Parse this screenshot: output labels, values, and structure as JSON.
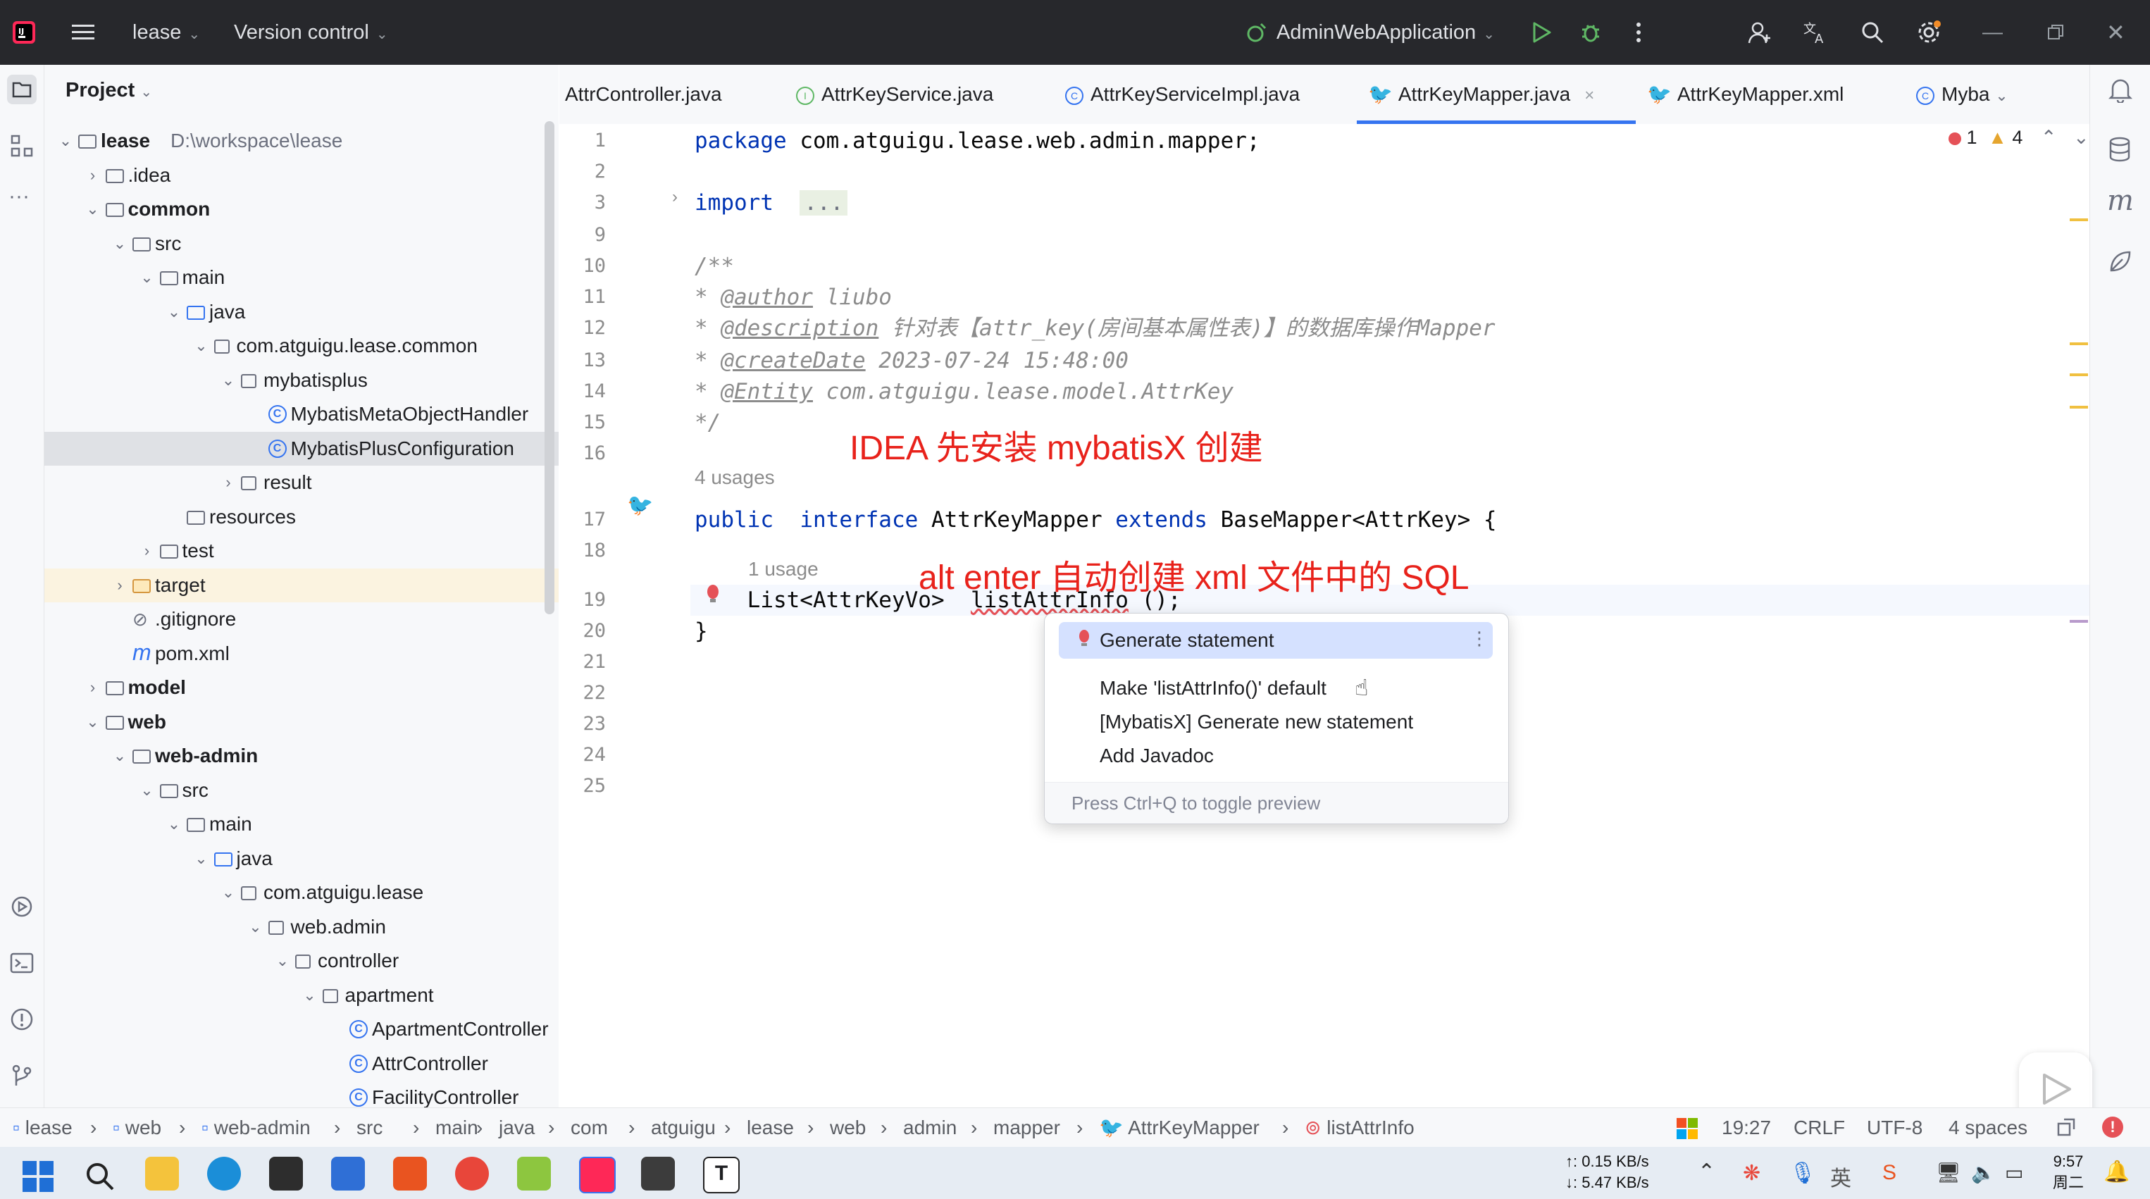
{
  "titlebar": {
    "project": "lease",
    "vcs": "Version control",
    "run_config": "AdminWebApplication"
  },
  "project_panel": {
    "title": "Project",
    "tree": [
      {
        "label": "lease",
        "suffix": "D:\\workspace\\lease",
        "depth": 0,
        "arrow": "open",
        "icon": "module",
        "bold": true
      },
      {
        "label": ".idea",
        "depth": 1,
        "arrow": "closed",
        "icon": "folder"
      },
      {
        "label": "common",
        "depth": 1,
        "arrow": "open",
        "icon": "module",
        "bold": true
      },
      {
        "label": "src",
        "depth": 2,
        "arrow": "open",
        "icon": "folder"
      },
      {
        "label": "main",
        "depth": 3,
        "arrow": "open",
        "icon": "folder"
      },
      {
        "label": "java",
        "depth": 4,
        "arrow": "open",
        "icon": "folder-blue"
      },
      {
        "label": "com.atguigu.lease.common",
        "depth": 5,
        "arrow": "open",
        "icon": "package"
      },
      {
        "label": "mybatisplus",
        "depth": 6,
        "arrow": "open",
        "icon": "package"
      },
      {
        "label": "MybatisMetaObjectHandler",
        "depth": 7,
        "arrow": "none",
        "icon": "class"
      },
      {
        "label": "MybatisPlusConfiguration",
        "depth": 7,
        "arrow": "none",
        "icon": "class",
        "selected": true
      },
      {
        "label": "result",
        "depth": 6,
        "arrow": "closed",
        "icon": "package"
      },
      {
        "label": "resources",
        "depth": 4,
        "arrow": "none",
        "icon": "folder"
      },
      {
        "label": "test",
        "depth": 3,
        "arrow": "closed",
        "icon": "folder"
      },
      {
        "label": "target",
        "depth": 2,
        "arrow": "closed",
        "icon": "folder-orange",
        "target": true
      },
      {
        "label": ".gitignore",
        "depth": 2,
        "arrow": "none",
        "icon": "ignore"
      },
      {
        "label": "pom.xml",
        "depth": 2,
        "arrow": "none",
        "icon": "maven"
      },
      {
        "label": "model",
        "depth": 1,
        "arrow": "closed",
        "icon": "module",
        "bold": true
      },
      {
        "label": "web",
        "depth": 1,
        "arrow": "open",
        "icon": "module",
        "bold": true
      },
      {
        "label": "web-admin",
        "depth": 2,
        "arrow": "open",
        "icon": "module",
        "bold": true
      },
      {
        "label": "src",
        "depth": 3,
        "arrow": "open",
        "icon": "folder"
      },
      {
        "label": "main",
        "depth": 4,
        "arrow": "open",
        "icon": "folder"
      },
      {
        "label": "java",
        "depth": 5,
        "arrow": "open",
        "icon": "folder-blue"
      },
      {
        "label": "com.atguigu.lease",
        "depth": 6,
        "arrow": "open",
        "icon": "package"
      },
      {
        "label": "web.admin",
        "depth": 7,
        "arrow": "open",
        "icon": "package"
      },
      {
        "label": "controller",
        "depth": 8,
        "arrow": "open",
        "icon": "package"
      },
      {
        "label": "apartment",
        "depth": 9,
        "arrow": "open",
        "icon": "package"
      },
      {
        "label": "ApartmentController",
        "depth": 10,
        "arrow": "none",
        "icon": "class"
      },
      {
        "label": "AttrController",
        "depth": 10,
        "arrow": "none",
        "icon": "class"
      },
      {
        "label": "FacilityController",
        "depth": 10,
        "arrow": "none",
        "icon": "class"
      }
    ]
  },
  "tabs": [
    {
      "label": "AttrController.java",
      "icon": "none"
    },
    {
      "label": "AttrKeyService.java",
      "icon": "interface"
    },
    {
      "label": "AttrKeyServiceImpl.java",
      "icon": "class"
    },
    {
      "label": "AttrKeyMapper.java",
      "icon": "mapper",
      "active": true,
      "closable": true
    },
    {
      "label": "AttrKeyMapper.xml",
      "icon": "mapper"
    },
    {
      "label": "Myba",
      "icon": "class"
    }
  ],
  "inspection": {
    "errors": "1",
    "warnings": "4"
  },
  "code_lines": [
    {
      "n": "1",
      "tokens": [
        [
          "kw",
          "package"
        ],
        [
          "",
          "com.atguigu.lease.web.admin.mapper;"
        ]
      ]
    },
    {
      "n": "2",
      "tokens": []
    },
    {
      "n": "3",
      "tokens": [
        [
          "kw",
          "import"
        ],
        [
          "",
          ""
        ],
        [
          "fold",
          "..."
        ]
      ]
    },
    {
      "n": "9",
      "tokens": []
    },
    {
      "n": "10",
      "tokens": [
        [
          "cm",
          "/**"
        ]
      ]
    },
    {
      "n": "11",
      "tokens": [
        [
          "cm",
          "* "
        ],
        [
          "tag",
          "@author"
        ],
        [
          "cm",
          " liubo"
        ]
      ]
    },
    {
      "n": "12",
      "tokens": [
        [
          "cm",
          "* "
        ],
        [
          "tag",
          "@description"
        ],
        [
          "cm",
          " 针对表【attr_key(房间基本属性表)】的数据库操作Mapper"
        ]
      ]
    },
    {
      "n": "13",
      "tokens": [
        [
          "cm",
          "* "
        ],
        [
          "tag",
          "@createDate"
        ],
        [
          "cm",
          " 2023-07-24 15:48:00"
        ]
      ]
    },
    {
      "n": "14",
      "tokens": [
        [
          "cm",
          "* "
        ],
        [
          "tag",
          "@Entity"
        ],
        [
          "cm",
          " com.atguigu.lease.model.AttrKey"
        ]
      ]
    },
    {
      "n": "15",
      "tokens": [
        [
          "cm",
          "*/"
        ]
      ]
    },
    {
      "n": "16",
      "tokens": []
    },
    {
      "n": "17",
      "tokens": [
        [
          "kw",
          "public"
        ],
        [
          "",
          ""
        ],
        [
          "kw",
          "interface"
        ],
        [
          "",
          "AttrKeyMapper"
        ],
        [
          "kw",
          "extends"
        ],
        [
          "",
          "BaseMapper<AttrKey> {"
        ]
      ]
    },
    {
      "n": "18",
      "tokens": []
    },
    {
      "n": "19",
      "tokens": [
        [
          "",
          "    List<AttrKeyVo> "
        ],
        [
          "err",
          "listAttrInfo"
        ],
        [
          "",
          "();"
        ]
      ]
    },
    {
      "n": "20",
      "tokens": [
        [
          "",
          "}"
        ]
      ]
    },
    {
      "n": "21",
      "tokens": []
    },
    {
      "n": "22",
      "tokens": []
    },
    {
      "n": "23",
      "tokens": []
    },
    {
      "n": "24",
      "tokens": []
    },
    {
      "n": "25",
      "tokens": []
    }
  ],
  "hints": {
    "usages_17": "4 usages",
    "usage_19": "1 usage"
  },
  "annotations": {
    "top": "IDEA 先安装 mybatisX 创建",
    "bottom": "alt enter 自动创建 xml 文件中的 SQL"
  },
  "popup": {
    "items": [
      "Generate statement",
      "Make 'listAttrInfo()' default",
      "[MybatisX] Generate new statement",
      "Add Javadoc"
    ],
    "footer": "Press Ctrl+Q to toggle preview"
  },
  "breadcrumbs": [
    "lease",
    "web",
    "web-admin",
    "src",
    "main",
    "java",
    "com",
    "atguigu",
    "lease",
    "web",
    "admin",
    "mapper",
    "AttrKeyMapper",
    "listAttrInfo"
  ],
  "status": {
    "position": "19:27",
    "line_sep": "CRLF",
    "encoding": "UTF-8",
    "indent": "4 spaces"
  },
  "taskbar": {
    "net_up": "↑: 0.15 KB/s",
    "net_down": "↓: 5.47 KB/s",
    "time": "9:57",
    "day": "周二"
  },
  "colors": {
    "keyword": "#0033b3",
    "comment": "#8c8c8c",
    "annotation_red": "#e8221b",
    "accent": "#3574f0"
  }
}
